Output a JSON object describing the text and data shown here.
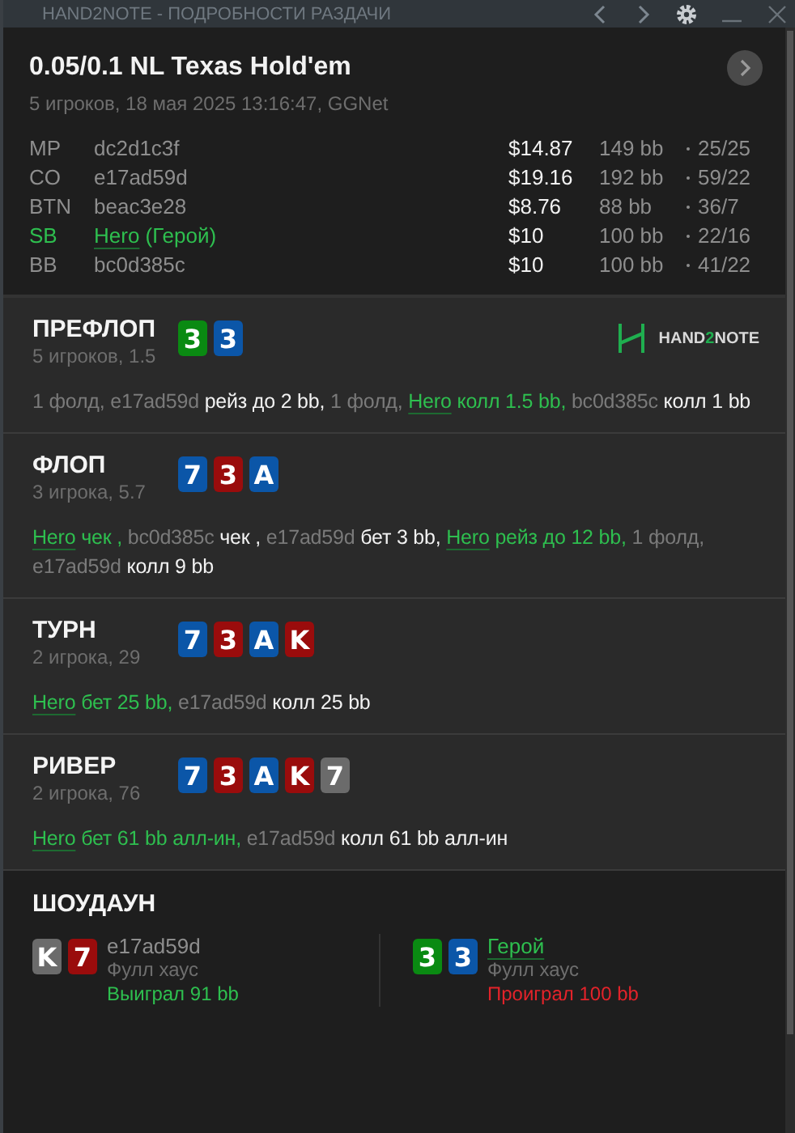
{
  "window": {
    "title": "HAND2NOTE - ПОДРОБНОСТИ РАЗДАЧИ",
    "buttons": [
      {
        "kind": "back"
      },
      {
        "kind": "forward"
      },
      {
        "kind": "settings"
      },
      {
        "kind": "minimize"
      },
      {
        "kind": "close"
      }
    ]
  },
  "hand": {
    "title": "0.05/0.1 NL Texas Hold'em",
    "subtitle": "5 игроков, 18 мая 2025 13:16:47, GGNet",
    "players": [
      {
        "position": "MP",
        "name": "dc2d1c3f",
        "hero": false,
        "stack": "$14.87",
        "bb": "149 bb",
        "stats": "25/25"
      },
      {
        "position": "CO",
        "name": "e17ad59d",
        "hero": false,
        "stack": "$19.16",
        "bb": "192 bb",
        "stats": "59/22"
      },
      {
        "position": "BTN",
        "name": "beac3e28",
        "hero": false,
        "stack": "$8.76",
        "bb": "88 bb",
        "stats": "36/7"
      },
      {
        "position": "SB",
        "name": "Hero",
        "suffix": "(Герой)",
        "hero": true,
        "stack": "$10",
        "bb": "100 bb",
        "stats": "22/16"
      },
      {
        "position": "BB",
        "name": "bc0d385c",
        "hero": false,
        "stack": "$10",
        "bb": "100 bb",
        "stats": "41/22"
      }
    ]
  },
  "streets": [
    {
      "title": "ПРЕФЛОП",
      "subtitle": "5 игроков, 1.5",
      "cards": [
        {
          "rank": "3",
          "color": "#0a8a12"
        },
        {
          "rank": "3",
          "color": "#0b56a8"
        }
      ],
      "logo": {
        "parts": [
          "HAND",
          "2",
          "NOTE"
        ]
      },
      "actions": [
        {
          "kind": "muted",
          "text": "1 фолд, e17ad59d "
        },
        {
          "kind": "action",
          "text": "рейз до 2 bb,"
        },
        {
          "kind": "muted",
          "text": " 1 фолд, "
        },
        {
          "kind": "hero",
          "text": "Hero"
        },
        {
          "kind": "hero-action",
          "text": " колл 1.5 bb,"
        },
        {
          "kind": "muted",
          "text": " bc0d385c "
        },
        {
          "kind": "action",
          "text": "колл 1 bb"
        }
      ]
    },
    {
      "title": "ФЛОП",
      "subtitle": "3 игрока, 5.7",
      "cards": [
        {
          "rank": "7",
          "color": "#0b56a8"
        },
        {
          "rank": "3",
          "color": "#9a0c0c"
        },
        {
          "rank": "A",
          "color": "#0b56a8"
        }
      ],
      "actions": [
        {
          "kind": "hero",
          "text": "Hero"
        },
        {
          "kind": "hero-action",
          "text": " чек ,"
        },
        {
          "kind": "muted",
          "text": " bc0d385c "
        },
        {
          "kind": "action",
          "text": "чек ,"
        },
        {
          "kind": "muted",
          "text": " e17ad59d "
        },
        {
          "kind": "action",
          "text": "бет 3 bb, "
        },
        {
          "kind": "hero",
          "text": "Hero"
        },
        {
          "kind": "hero-action",
          "text": " рейз до 12 bb,"
        },
        {
          "kind": "muted",
          "text": " 1 фолд, e17ad59d "
        },
        {
          "kind": "action",
          "text": "колл 9 bb"
        }
      ]
    },
    {
      "title": "ТУРН",
      "subtitle": "2 игрока, 29",
      "cards": [
        {
          "rank": "7",
          "color": "#0b56a8"
        },
        {
          "rank": "3",
          "color": "#9a0c0c"
        },
        {
          "rank": "A",
          "color": "#0b56a8"
        },
        {
          "rank": "K",
          "color": "#9a0c0c"
        }
      ],
      "actions": [
        {
          "kind": "hero",
          "text": "Hero"
        },
        {
          "kind": "hero-action",
          "text": " бет 25 bb,"
        },
        {
          "kind": "muted",
          "text": " e17ad59d "
        },
        {
          "kind": "action",
          "text": "колл 25 bb"
        }
      ]
    },
    {
      "title": "РИВЕР",
      "subtitle": "2 игрока, 76",
      "cards": [
        {
          "rank": "7",
          "color": "#0b56a8"
        },
        {
          "rank": "3",
          "color": "#9a0c0c"
        },
        {
          "rank": "A",
          "color": "#0b56a8"
        },
        {
          "rank": "K",
          "color": "#9a0c0c"
        },
        {
          "rank": "7",
          "color": "#6b6b6b"
        }
      ],
      "actions": [
        {
          "kind": "hero",
          "text": "Hero"
        },
        {
          "kind": "hero-action",
          "text": " бет 61 bb алл-ин,"
        },
        {
          "kind": "muted",
          "text": " e17ad59d "
        },
        {
          "kind": "action",
          "text": "колл 61 bb алл-ин"
        }
      ]
    }
  ],
  "showdown": {
    "title": "ШОУДАУН",
    "players": [
      {
        "name": "e17ad59d",
        "hero": false,
        "cards": [
          {
            "rank": "K",
            "color": "#6b6b6b"
          },
          {
            "rank": "7",
            "color": "#9a0c0c"
          }
        ],
        "hand": "Фулл хаус",
        "result": "Выиграл 91 bb",
        "won": true
      },
      {
        "name": "Герой",
        "hero": true,
        "cards": [
          {
            "rank": "3",
            "color": "#0a8a12"
          },
          {
            "rank": "3",
            "color": "#0b56a8"
          }
        ],
        "hand": "Фулл хаус",
        "result": "Проиграл 100 bb",
        "won": false
      }
    ]
  }
}
